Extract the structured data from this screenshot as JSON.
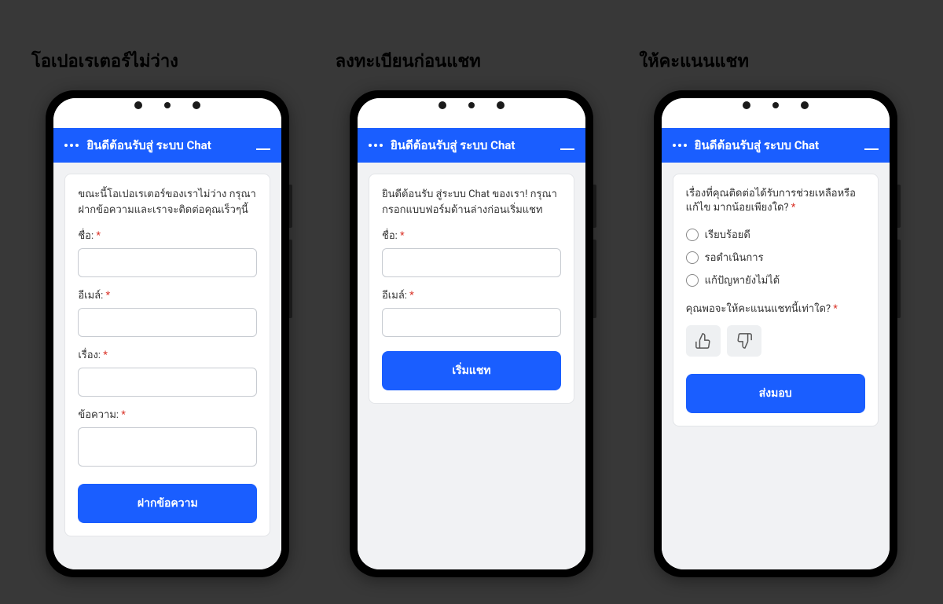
{
  "columns": [
    {
      "title": "โอเปอเรเตอร์ไม่ว่าง",
      "header": "ยินดีต้อนรับสู่ ระบบ Chat",
      "intro": "ขณะนี้โอเปอเรเตอร์ของเราไม่ว่าง กรุณาฝากข้อความและเราจะติดต่อคุณเร็วๆนี้",
      "fields": {
        "name_label": "ชื่อ:",
        "email_label": "อีเมล์:",
        "subject_label": "เรื่อง:",
        "message_label": "ข้อความ:"
      },
      "button": "ฝากข้อความ"
    },
    {
      "title": "ลงทะเบียนก่อนแชท",
      "header": "ยินดีต้อนรับสู่ ระบบ Chat",
      "intro": "ยินดีต้อนรับ สู่ระบบ Chat ของเรา! กรุณากรอกแบบฟอร์มด้านล่างก่อนเริ่มแชท",
      "fields": {
        "name_label": "ชื่อ:",
        "email_label": "อีเมล์:"
      },
      "button": "เริ่มแชท"
    },
    {
      "title": "ให้คะแนนแชท",
      "header": "ยินดีต้อนรับสู่ ระบบ Chat",
      "question1": "เรื่องที่คุณติดต่อได้รับการช่วยเหลือหรือแก้ไข มากน้อยเพียงใด?",
      "options": [
        "เรียบร้อยดี",
        "รอดำเนินการ",
        "แก้ปัญหายังไม่ได้"
      ],
      "question2": "คุณพอจะให้คะแนนแชทนี้เท่าใด?",
      "button": "ส่งมอบ"
    }
  ]
}
